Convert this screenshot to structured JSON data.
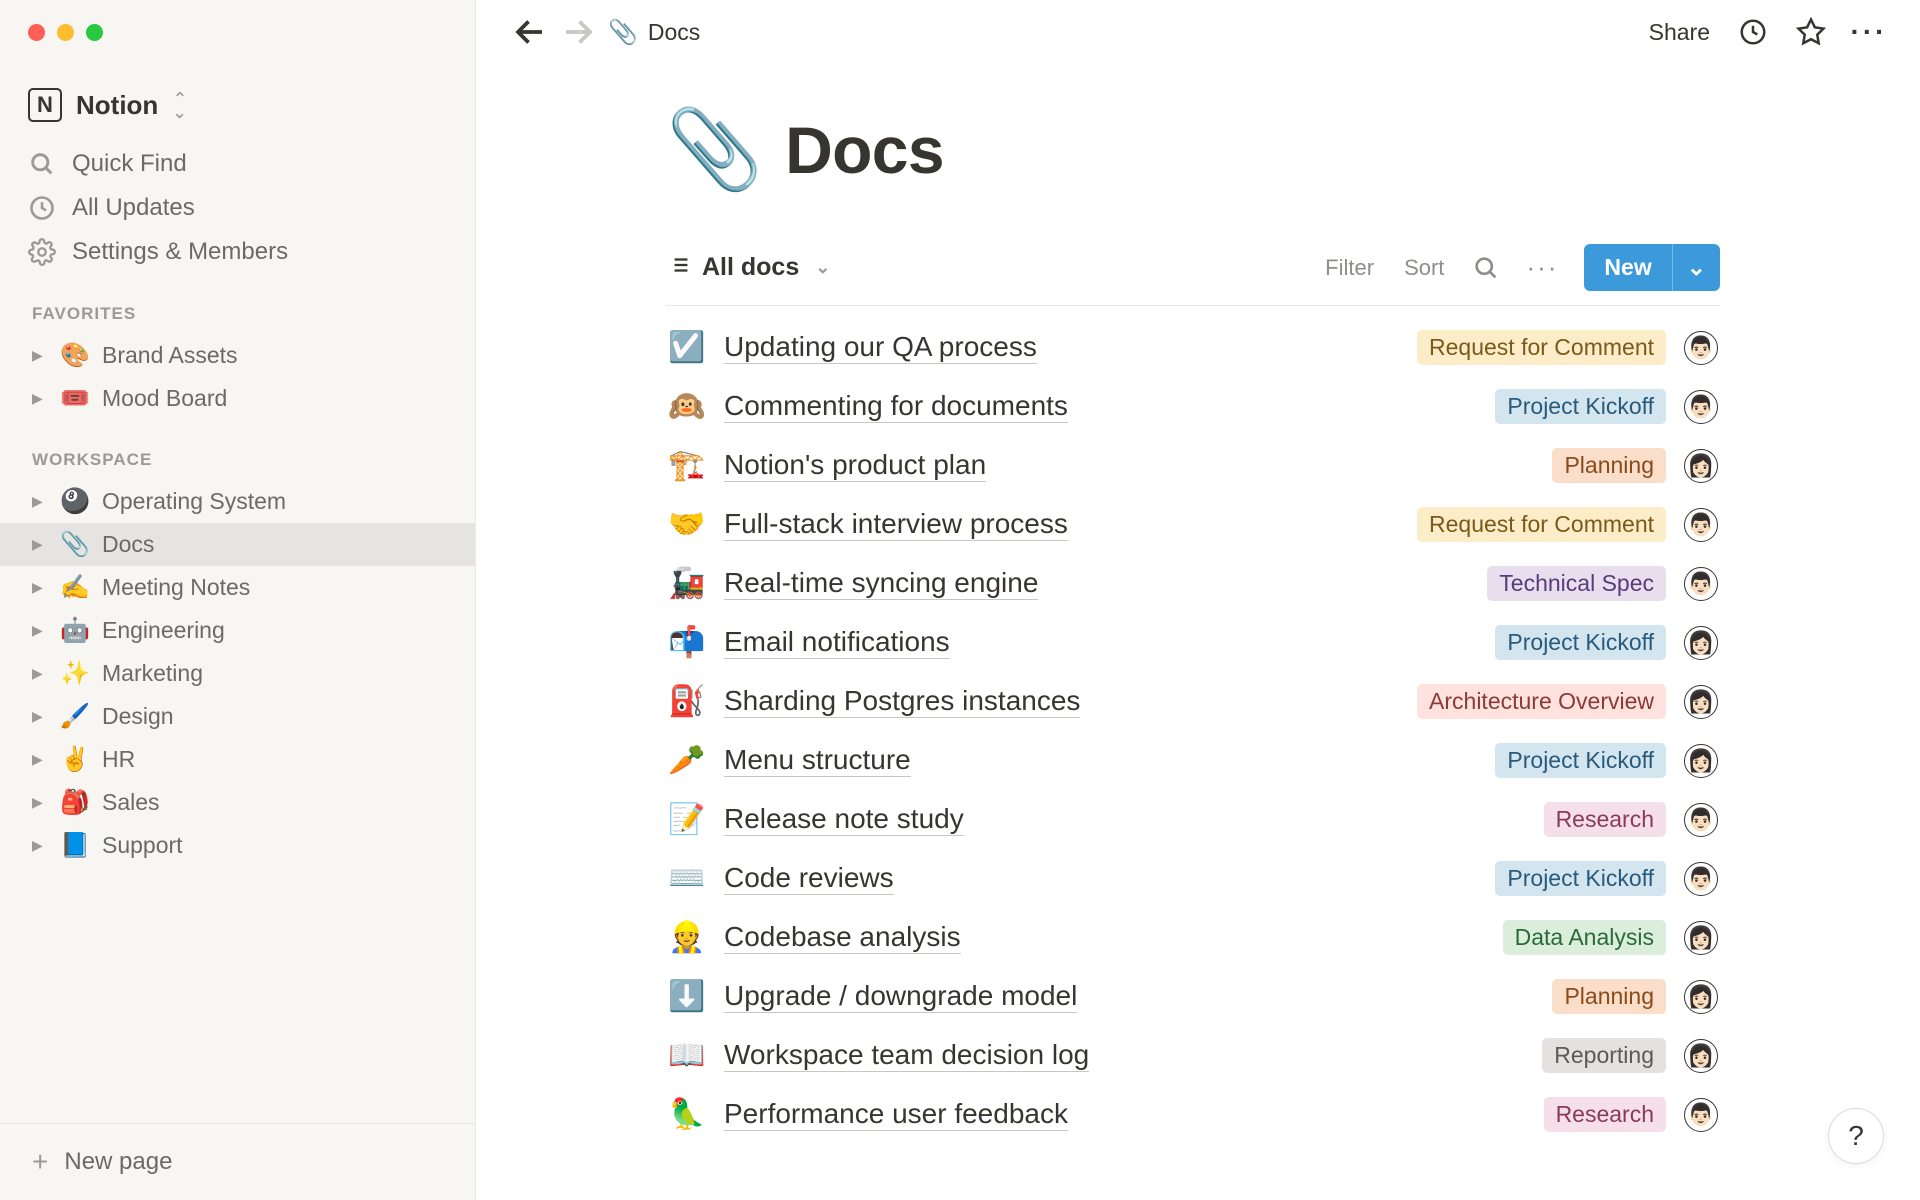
{
  "workspace": {
    "name": "Notion",
    "logo_letter": "N"
  },
  "sidebar": {
    "quickfind": "Quick Find",
    "updates": "All Updates",
    "settings": "Settings & Members",
    "sections": [
      {
        "heading": "Favorites",
        "items": [
          {
            "emoji": "🎨",
            "label": "Brand Assets"
          },
          {
            "emoji": "🎟️",
            "label": "Mood Board"
          }
        ]
      },
      {
        "heading": "Workspace",
        "items": [
          {
            "emoji": "🎱",
            "label": "Operating System"
          },
          {
            "emoji": "📎",
            "label": "Docs",
            "active": true
          },
          {
            "emoji": "✍️",
            "label": "Meeting Notes"
          },
          {
            "emoji": "🤖",
            "label": "Engineering"
          },
          {
            "emoji": "✨",
            "label": "Marketing"
          },
          {
            "emoji": "🖌️",
            "label": "Design"
          },
          {
            "emoji": "✌️",
            "label": "HR"
          },
          {
            "emoji": "🎒",
            "label": "Sales"
          },
          {
            "emoji": "📘",
            "label": "Support"
          }
        ]
      }
    ],
    "new_page": "New page"
  },
  "topbar": {
    "breadcrumb_emoji": "📎",
    "breadcrumb_label": "Docs",
    "share": "Share"
  },
  "page": {
    "emoji": "📎",
    "title": "Docs"
  },
  "view": {
    "tab_label": "All docs",
    "filter": "Filter",
    "sort": "Sort",
    "new": "New"
  },
  "tags": {
    "rfc": {
      "label": "Request for Comment",
      "cls": "tag-yellow"
    },
    "kickoff": {
      "label": "Project Kickoff",
      "cls": "tag-blue"
    },
    "planning": {
      "label": "Planning",
      "cls": "tag-orange"
    },
    "techspec": {
      "label": "Technical Spec",
      "cls": "tag-purple"
    },
    "archover": {
      "label": "Architecture Overview",
      "cls": "tag-red"
    },
    "research": {
      "label": "Research",
      "cls": "tag-pink"
    },
    "dataan": {
      "label": "Data Analysis",
      "cls": "tag-green"
    },
    "reporting": {
      "label": "Reporting",
      "cls": "tag-gray"
    }
  },
  "docs": [
    {
      "emoji": "☑️",
      "title": "Updating our QA process",
      "tag": "rfc",
      "avatar": "👨🏻"
    },
    {
      "emoji": "🙉",
      "title": "Commenting for documents",
      "tag": "kickoff",
      "avatar": "👨🏻"
    },
    {
      "emoji": "🏗️",
      "title": "Notion's product plan",
      "tag": "planning",
      "avatar": "👩🏻"
    },
    {
      "emoji": "🤝",
      "title": "Full-stack interview process",
      "tag": "rfc",
      "avatar": "👨🏻"
    },
    {
      "emoji": "🚂",
      "title": "Real-time syncing engine",
      "tag": "techspec",
      "avatar": "👨🏻"
    },
    {
      "emoji": "📬",
      "title": "Email notifications",
      "tag": "kickoff",
      "avatar": "👩🏻"
    },
    {
      "emoji": "⛽",
      "title": "Sharding Postgres instances",
      "tag": "archover",
      "avatar": "👩🏻"
    },
    {
      "emoji": "🥕",
      "title": "Menu structure",
      "tag": "kickoff",
      "avatar": "👩🏻"
    },
    {
      "emoji": "📝",
      "title": "Release note study",
      "tag": "research",
      "avatar": "👨🏻"
    },
    {
      "emoji": "⌨️",
      "title": "Code reviews",
      "tag": "kickoff",
      "avatar": "👨🏻"
    },
    {
      "emoji": "👷",
      "title": "Codebase analysis",
      "tag": "dataan",
      "avatar": "👩🏻"
    },
    {
      "emoji": "⬇️",
      "title": "Upgrade / downgrade model",
      "tag": "planning",
      "avatar": "👩🏻"
    },
    {
      "emoji": "📖",
      "title": "Workspace team decision log",
      "tag": "reporting",
      "avatar": "👩🏻"
    },
    {
      "emoji": "🦜",
      "title": "Performance user feedback",
      "tag": "research",
      "avatar": "👨🏻"
    }
  ]
}
